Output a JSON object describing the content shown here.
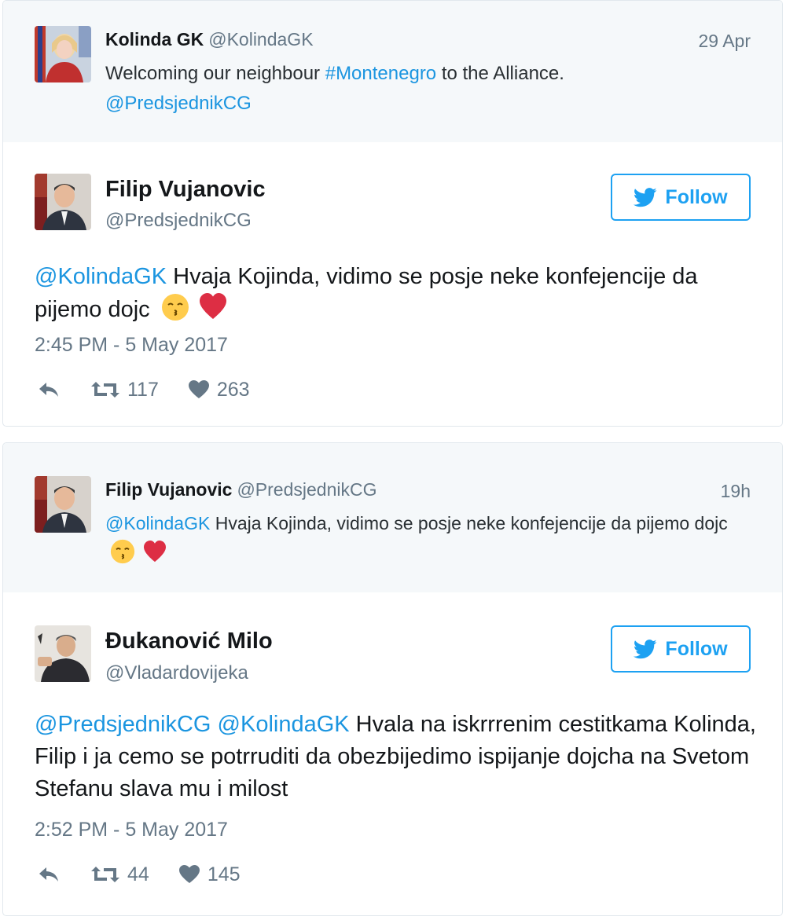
{
  "tweet1": {
    "quoted": {
      "name": "Kolinda GK",
      "handle": "@KolindaGK",
      "time": "29 Apr",
      "text_before": "Welcoming our neighbour ",
      "hashtag": "#Montenegro",
      "text_after": " to the Alliance.",
      "mention": "@PredsjednikCG"
    },
    "main": {
      "name": "Filip Vujanovic",
      "handle": "@PredsjednikCG",
      "follow_label": "Follow",
      "mention": "@KolindaGK",
      "text": " Hvaja Kojinda, vidimo se posje neke konfejencije da pijemo dojc",
      "date": "2:45 PM - 5 May 2017",
      "retweets": "117",
      "likes": "263"
    }
  },
  "tweet2": {
    "quoted": {
      "name": "Filip Vujanovic",
      "handle": "@PredsjednikCG",
      "time": "19h",
      "mention": "@KolindaGK",
      "text": " Hvaja Kojinda, vidimo se posje neke konfejencije da pijemo dojc"
    },
    "main": {
      "name": "Đukanović Milo",
      "handle": "@Vladardovijeka",
      "follow_label": "Follow",
      "mention1": "@PredsjednikCG",
      "mention2": "@KolindaGK",
      "text": " Hvala na iskrrrenim cestitkama Kolinda, Filip i ja cemo se potrruditi da obezbijedimo ispijanje dojcha na Svetom Stefanu slava mu i milost",
      "date": "2:52 PM - 5 May 2017",
      "retweets": "44",
      "likes": "145"
    }
  },
  "colors": {
    "link": "#1b95e0",
    "follow": "#1da1f2",
    "quoted_bg": "#f5f8fa",
    "muted": "#657786",
    "heart": "#e0245e"
  },
  "icons": [
    "reply-icon",
    "retweet-icon",
    "like-icon",
    "twitter-bird-icon",
    "kissing-emoji-icon",
    "red-heart-icon"
  ]
}
